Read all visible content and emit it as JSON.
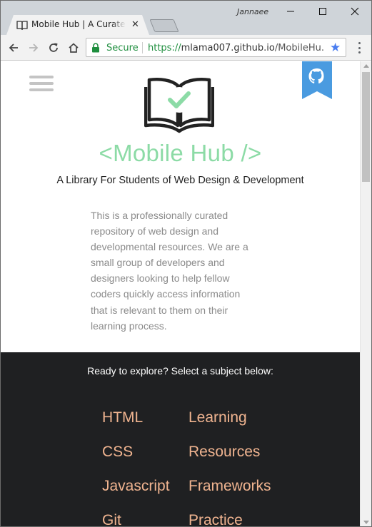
{
  "browser": {
    "profile_name": "Jannaee",
    "tab": {
      "title": "Mobile Hub | A Curated Collection",
      "close_label": "✕"
    },
    "omnibox": {
      "security_label": "Secure",
      "url_scheme": "https://",
      "url_host": "mlama007.github.io",
      "url_path": "/MobileHu..."
    }
  },
  "page": {
    "title": "<Mobile Hub />",
    "tagline": "A Library For Students of Web Design & Development",
    "intro": "This is a professionally curated repository of web design and developmental resources. We are a small group of developers and designers looking to help fellow coders quickly access information that is relevant to them on their learning process.",
    "explore": {
      "heading": "Ready to explore? Select a subject below:",
      "subjects_left": [
        "HTML",
        "CSS",
        "Javascript",
        "Git"
      ],
      "subjects_right": [
        "Learning",
        "Resources",
        "Frameworks",
        "Practice"
      ]
    }
  },
  "colors": {
    "accent_green": "#8cdba6",
    "subject_link": "#f0b490",
    "github_ribbon": "#4a9be0",
    "dark_section": "#1f2022"
  },
  "icons": [
    "book-favicon-icon",
    "back-arrow-icon",
    "forward-arrow-icon",
    "reload-icon",
    "home-icon",
    "lock-icon",
    "star-icon",
    "menu-dots-icon",
    "hamburger-menu-icon",
    "github-octocat-icon",
    "book-check-logo-icon"
  ]
}
